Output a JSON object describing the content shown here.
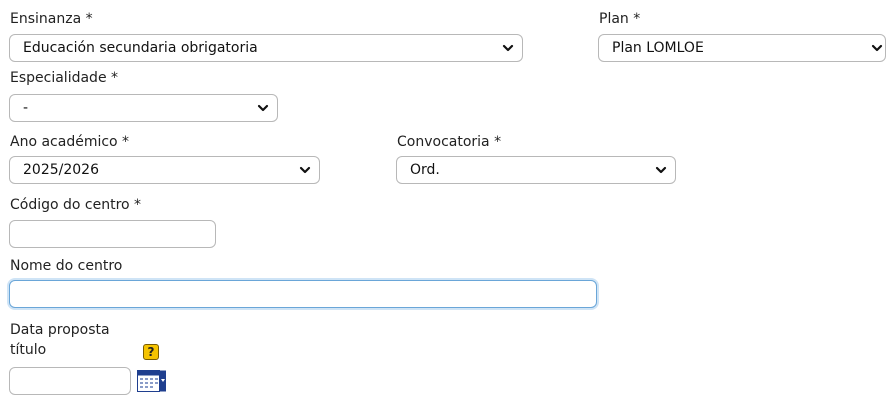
{
  "ensinanza": {
    "label": "Ensinanza *",
    "value": "Educación secundaria obrigatoria"
  },
  "plan": {
    "label": "Plan *",
    "value": "Plan LOMLOE"
  },
  "especialidade": {
    "label": "Especialidade *",
    "value": "-"
  },
  "ano_academico": {
    "label": "Ano académico *",
    "value": "2025/2026"
  },
  "convocatoria": {
    "label": "Convocatoria *",
    "value": "Ord."
  },
  "codigo_centro": {
    "label": "Código do centro *",
    "value": ""
  },
  "nome_centro": {
    "label": "Nome do centro",
    "value": ""
  },
  "data_proposta": {
    "label_line1": "Data proposta",
    "label_line2": "título",
    "value": "",
    "help_glyph": "?"
  },
  "icons": {
    "chevron": "chevron-down-icon",
    "help": "help-icon",
    "calendar": "calendar-icon"
  },
  "colors": {
    "focus_border": "#6aa6d8",
    "help_yellow": "#f5c300",
    "calendar_blue": "#1f3f8f"
  }
}
